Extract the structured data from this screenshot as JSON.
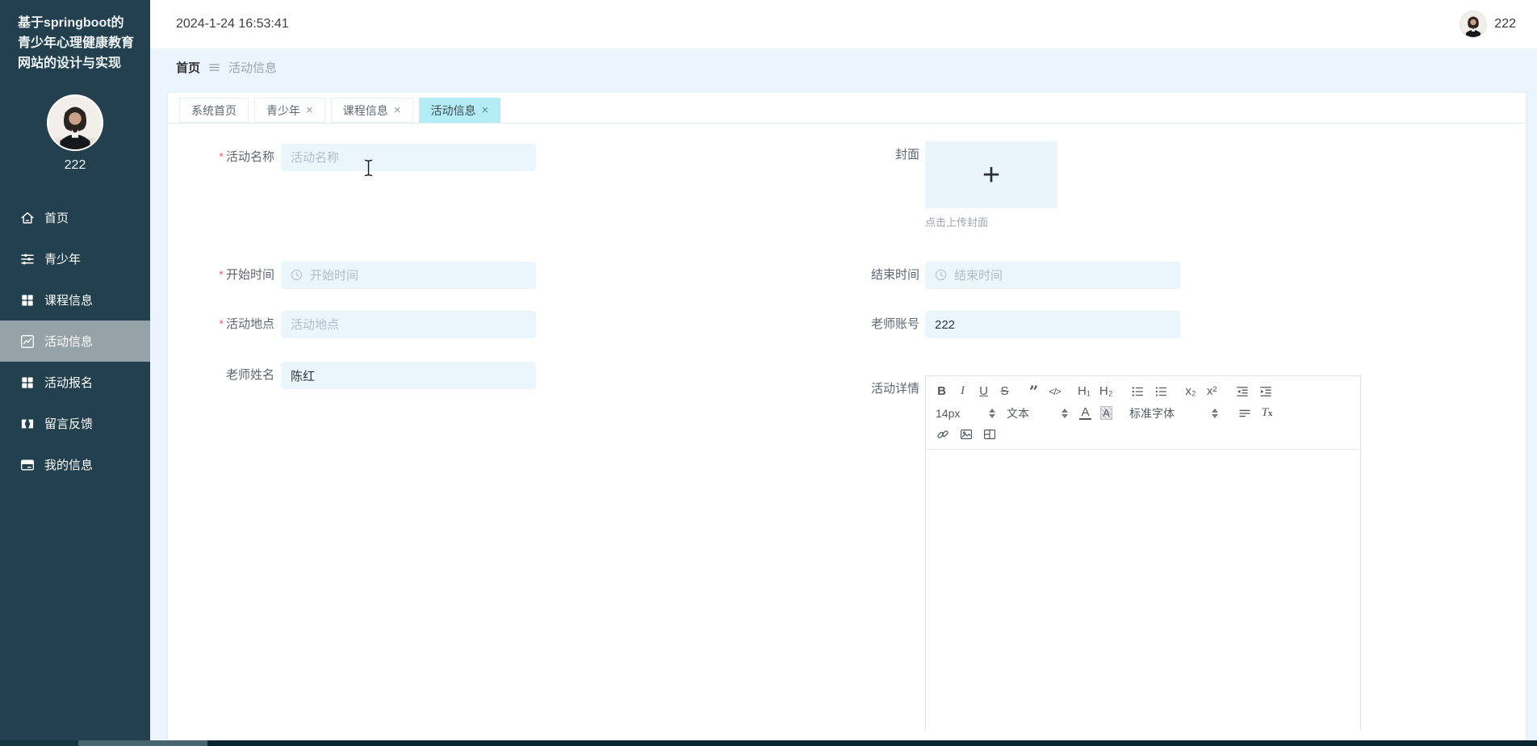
{
  "app": {
    "title": "基于springboot的青少年心理健康教育网站的设计与实现"
  },
  "sidebar": {
    "username": "222",
    "items": [
      {
        "label": "首页",
        "icon": "home-icon"
      },
      {
        "label": "青少年",
        "icon": "sliders-icon"
      },
      {
        "label": "课程信息",
        "icon": "grid-icon"
      },
      {
        "label": "活动信息",
        "icon": "chart-icon",
        "active": true
      },
      {
        "label": "活动报名",
        "icon": "grid-icon"
      },
      {
        "label": "留言反馈",
        "icon": "feedback-icon"
      },
      {
        "label": "我的信息",
        "icon": "card-icon"
      }
    ]
  },
  "topbar": {
    "timestamp": "2024-1-24 16:53:41",
    "username": "222"
  },
  "breadcrumb": {
    "home": "首页",
    "separator_icon": "menu-lines-icon",
    "current": "活动信息"
  },
  "tabs": [
    {
      "label": "系统首页"
    },
    {
      "label": "青少年",
      "close": "×"
    },
    {
      "label": "课程信息",
      "close": "×"
    },
    {
      "label": "活动信息",
      "close": "×",
      "active": true
    }
  ],
  "form": {
    "activity_name": {
      "required": "*",
      "label": "活动名称",
      "placeholder": "活动名称",
      "value": ""
    },
    "cover": {
      "label": "封面",
      "plus": "+",
      "upload_hint": "点击上传封面"
    },
    "start_time": {
      "required": "*",
      "label": "开始时间",
      "placeholder": "开始时间",
      "icon": "clock-icon"
    },
    "end_time": {
      "label": "结束时间",
      "placeholder": "结束时间",
      "icon": "clock-icon"
    },
    "location": {
      "required": "*",
      "label": "活动地点",
      "placeholder": "活动地点",
      "value": ""
    },
    "teacher_account": {
      "label": "老师账号",
      "value": "222"
    },
    "teacher_name": {
      "label": "老师姓名",
      "value": "陈红"
    },
    "detail": {
      "label": "活动详情"
    }
  },
  "editor": {
    "toolbar": {
      "bold": "B",
      "italic": "I",
      "underline": "U",
      "strike": "S",
      "quote": "”",
      "code": "</>",
      "h1": "H₁",
      "h2": "H₂",
      "subscript": "x₂",
      "superscript": "x²",
      "font_size": "14px",
      "format": "文本",
      "text_color": "A",
      "highlight": "A",
      "font_family": "标准字体",
      "clear_format_t": "T",
      "clear_format_x": "x",
      "icons": [
        "ordered-list-icon",
        "unordered-list-icon",
        "outdent-icon",
        "indent-icon",
        "align-icon",
        "link-icon",
        "image-icon",
        "video-icon"
      ]
    },
    "content": ""
  },
  "colors": {
    "sidebar_bg": "#22404d",
    "content_bg": "#ecf5fd",
    "input_bg": "#eaf5fc",
    "active_tab_bg": "#b3ecf4",
    "required_star": "#f56c6c",
    "scroll_track": "#0a2731",
    "scroll_thumb": "#47646f"
  }
}
